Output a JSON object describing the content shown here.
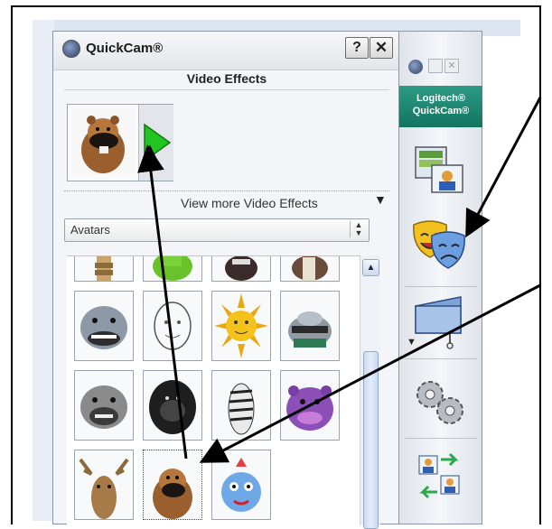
{
  "window": {
    "title": "QuickCam®",
    "help_label": "?",
    "close_label": "✕"
  },
  "section": {
    "title": "Video Effects"
  },
  "preview": {
    "play_icon": "play-icon"
  },
  "view_more": {
    "label": "View more Video Effects",
    "arrow": "▼"
  },
  "dropdown": {
    "value": "Avatars",
    "arrow": "▲▼"
  },
  "scrollbar": {
    "up_arrow": "▲"
  },
  "sidebar": {
    "brand_line1": "Logitech®",
    "brand_line2": "QuickCam®",
    "close_label": "✕",
    "expand_arrow": "▼",
    "buttons": [
      "video-effects-window-icon",
      "theater-masks-icon",
      "camera-icon",
      "gears-icon",
      "swap-users-icon"
    ]
  },
  "avatars": [
    "spine",
    "green-alien",
    "skull",
    "zebra-partial",
    "shark",
    "sketch-face",
    "sun",
    "robot-head",
    "bulldog",
    "gorilla",
    "zebra",
    "purple-hippo",
    "moose",
    "beaver",
    "fish"
  ],
  "colors": {
    "brand": "#137561",
    "play": "#22c422",
    "arrow": "#000000"
  }
}
